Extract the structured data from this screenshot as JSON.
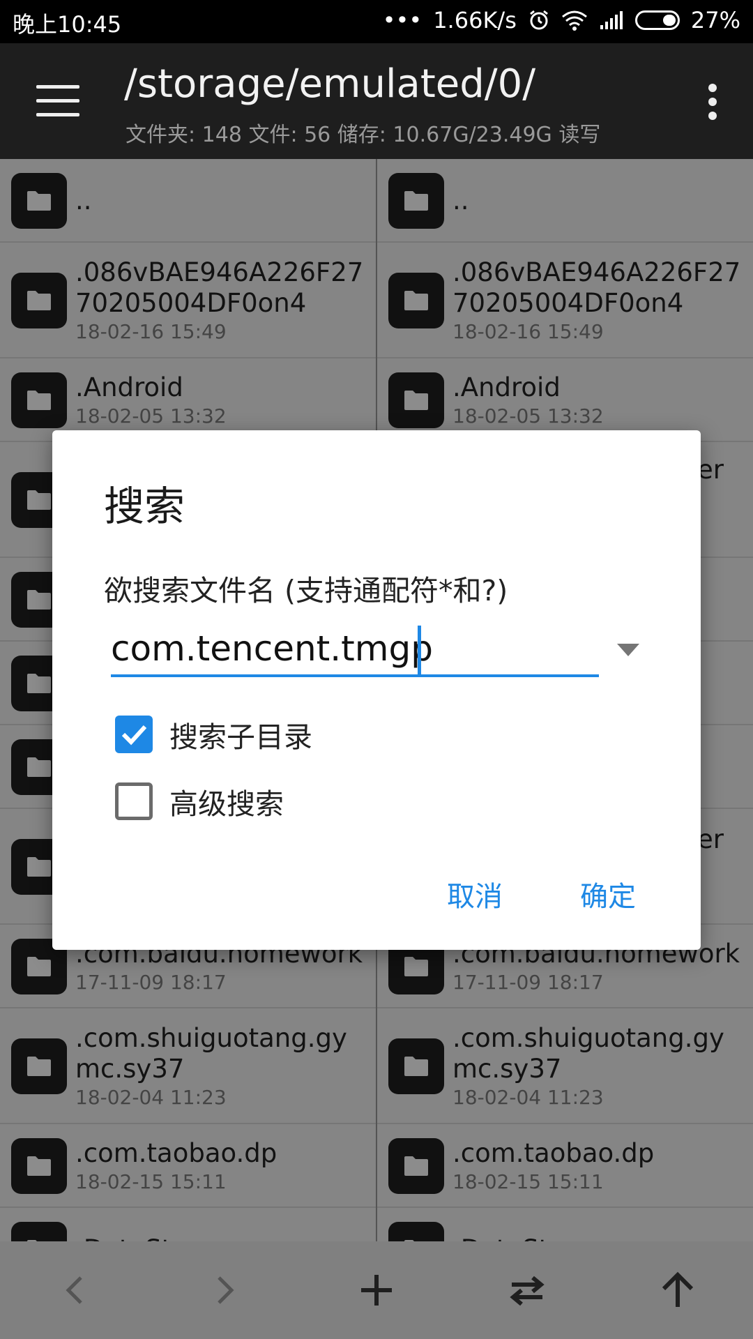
{
  "status_bar": {
    "time": "晚上10:45",
    "dots": "•••",
    "speed": "1.66K/s",
    "battery": "27%"
  },
  "toolbar": {
    "path": "/storage/emulated/0/",
    "info": "文件夹: 148  文件: 56  储存: 10.67G/23.49G  读写"
  },
  "files": [
    {
      "name": "..",
      "date": ""
    },
    {
      "name": ".086vBAE946A226F27\n70205004DF0on4",
      "date": "18-02-16 15:49"
    },
    {
      "name": ".Android",
      "date": "18-02-05 13:32"
    },
    {
      "name": "",
      "date": ""
    },
    {
      "name": "",
      "date": ""
    },
    {
      "name": "",
      "date": ""
    },
    {
      "name": "",
      "date": ""
    },
    {
      "name": "",
      "date": ""
    },
    {
      "name": ".com.baidu.homework",
      "date": "17-11-09 18:17"
    },
    {
      "name": ".com.shuiguotang.gy\nmc.sy37",
      "date": "18-02-04 11:23"
    },
    {
      "name": ".com.taobao.dp",
      "date": "18-02-15 15:11"
    },
    {
      "name": ".DataStorage",
      "date": ""
    }
  ],
  "right_pane_peek": {
    "row4_tail": "er",
    "row8_tail": "er"
  },
  "dialog": {
    "title": "搜索",
    "label": "欲搜索文件名 (支持通配符*和?)",
    "input_value": "com.tencent.tmgp",
    "option_subdirs": "搜索子目录",
    "option_subdirs_checked": true,
    "option_advanced": "高级搜索",
    "option_advanced_checked": false,
    "cancel": "取消",
    "confirm": "确定"
  },
  "icons": {
    "menu": "hamburger-icon",
    "more": "more-vert-icon",
    "back": "chevron-left-icon",
    "forward": "chevron-right-icon",
    "add": "plus-icon",
    "swap": "swap-icon",
    "up": "arrow-up-icon"
  },
  "colors": {
    "accent": "#1e88e5"
  }
}
